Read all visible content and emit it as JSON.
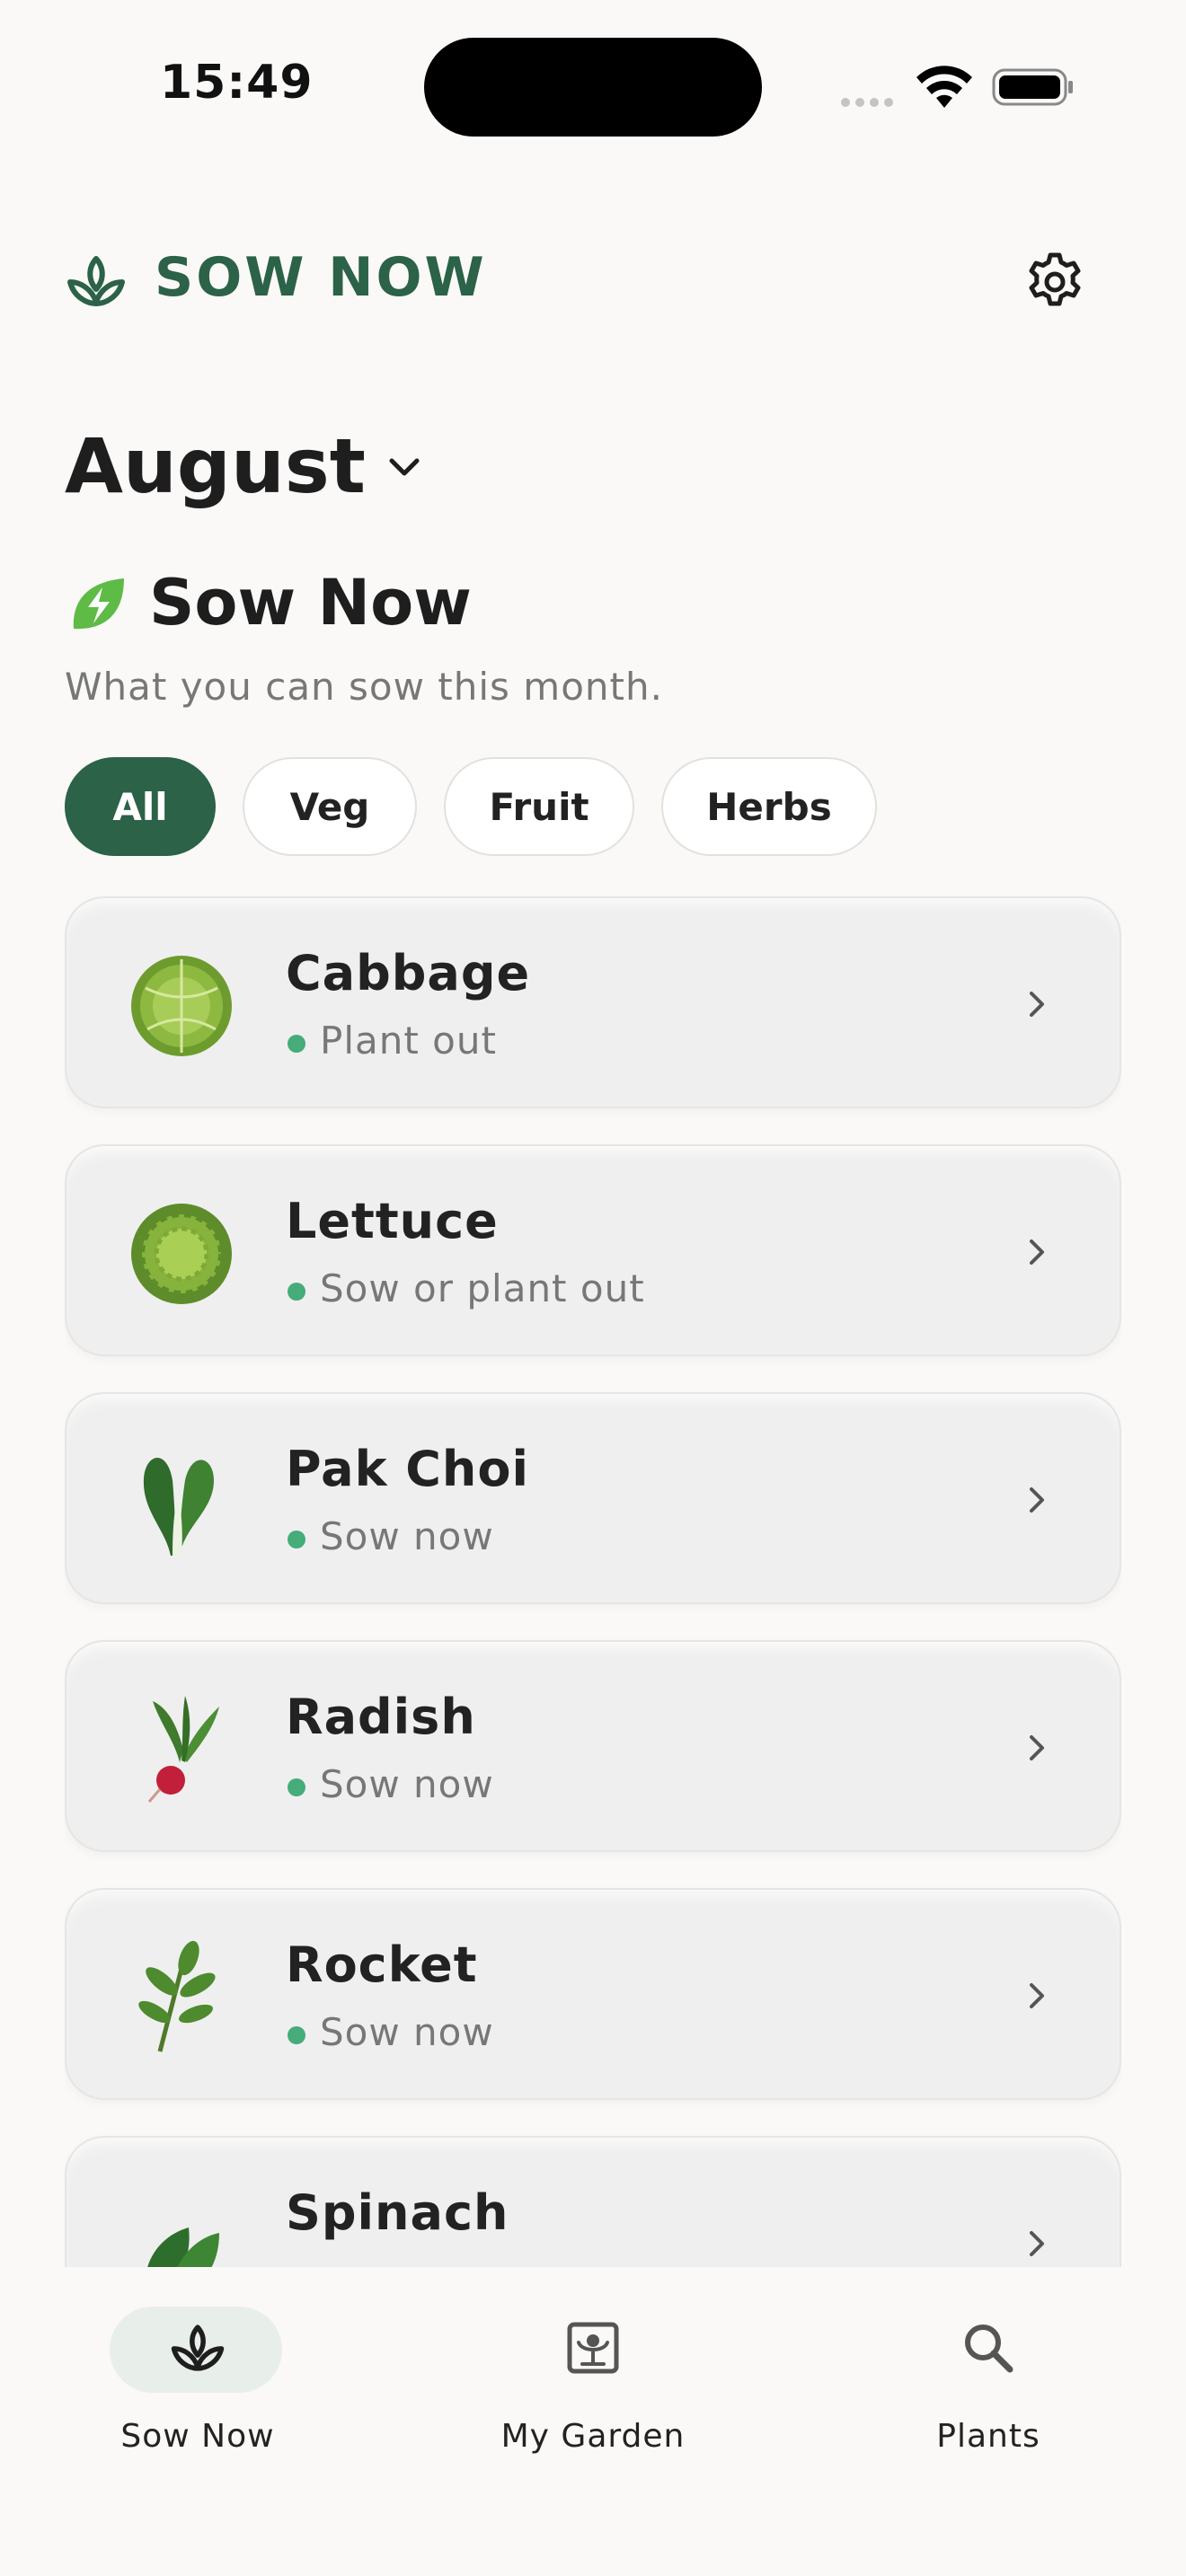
{
  "status_bar": {
    "time": "15:49"
  },
  "header": {
    "title": "SOW NOW",
    "icon": "sprout-icon",
    "settings_icon": "gear-icon"
  },
  "month_selector": {
    "label": "August",
    "icon": "chevron-down-icon"
  },
  "section": {
    "icon": "leaf-bolt-icon",
    "title": "Sow Now",
    "subtitle": "What you can sow this month."
  },
  "filters": [
    {
      "label": "All",
      "active": true
    },
    {
      "label": "Veg",
      "active": false
    },
    {
      "label": "Fruit",
      "active": false
    },
    {
      "label": "Herbs",
      "active": false
    }
  ],
  "plants": [
    {
      "name": "Cabbage",
      "status": "Plant out",
      "icon": "cabbage-icon"
    },
    {
      "name": "Lettuce",
      "status": "Sow or plant out",
      "icon": "lettuce-icon"
    },
    {
      "name": "Pak Choi",
      "status": "Sow now",
      "icon": "pak-choi-icon"
    },
    {
      "name": "Radish",
      "status": "Sow now",
      "icon": "radish-icon"
    },
    {
      "name": "Rocket",
      "status": "Sow now",
      "icon": "rocket-icon"
    },
    {
      "name": "Spinach",
      "status": "",
      "icon": "spinach-icon"
    }
  ],
  "colors": {
    "brand": "#2B6248",
    "status_dot": "#45AC7A",
    "background": "#FAF9F7"
  },
  "nav": [
    {
      "label": "Sow Now",
      "icon": "sprout-icon",
      "active": true
    },
    {
      "label": "My Garden",
      "icon": "garden-icon",
      "active": false
    },
    {
      "label": "Plants",
      "icon": "search-icon",
      "active": false
    }
  ]
}
